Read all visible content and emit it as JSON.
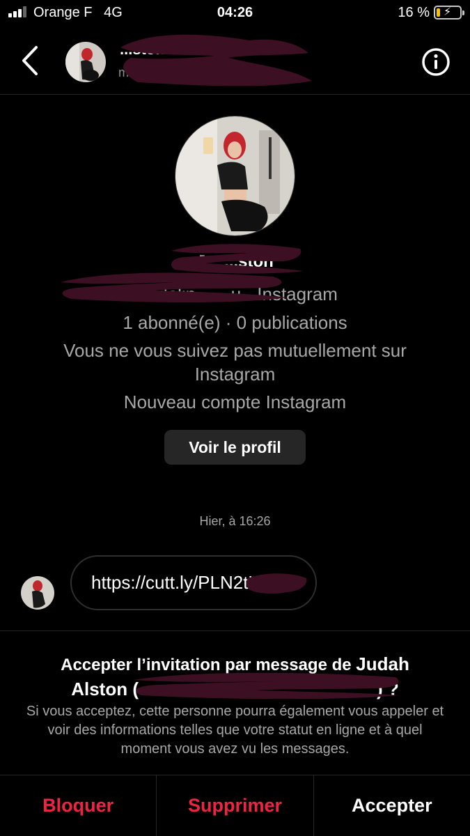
{
  "status_bar": {
    "carrier": "Orange F",
    "network": "4G",
    "time": "04:26",
    "battery_pct": "16 %",
    "battery_level": 0.16
  },
  "header": {
    "name": "...ston",
    "username": "m...u3iouu"
  },
  "profile": {
    "name": "J... ...ston",
    "handle_line": "madelin... ...u · Instagram",
    "stats": "1 abonné(e) · 0 publications",
    "mutual_line1": "Vous ne vous suivez pas mutuellement sur",
    "mutual_line2": "Instagram",
    "new_account": "Nouveau compte Instagram",
    "view_profile": "Voir le profil"
  },
  "thread": {
    "timestamp": "Hier, à 16:26",
    "message": "https://cutt.ly/PLN2tLk"
  },
  "invite": {
    "title_prefix": "Accepter l’invitation par message de ",
    "title_name_1": "Judah",
    "title_name_2": "Alston",
    "title_paren": " (",
    "title_suffix": ") ?",
    "body": "Si vous acceptez, cette personne pourra également vous appeler et voir des informations telles que votre statut en ligne et à quel moment vous avez vu les messages."
  },
  "actions": {
    "block": "Bloquer",
    "delete": "Supprimer",
    "accept": "Accepter"
  },
  "colors": {
    "background": "#000000",
    "danger": "#ed2444",
    "secondary_text": "#a8a8a8",
    "redaction": "#3d0f22"
  }
}
